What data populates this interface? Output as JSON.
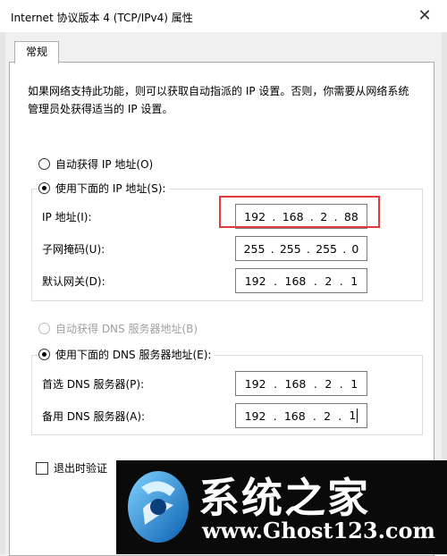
{
  "window": {
    "title": "Internet 协议版本 4 (TCP/IPv4) 属性",
    "close_symbol": "✕"
  },
  "tabs": [
    {
      "label": "常规"
    }
  ],
  "description": "如果网络支持此功能，则可以获取自动指派的 IP 设置。否则，你需要从网络系统管理员处获得适当的 IP 设置。",
  "ip_section": {
    "auto_label": "自动获得 IP 地址(O)",
    "manual_label": "使用下面的 IP 地址(S):",
    "fields": [
      {
        "label": "IP 地址(I):",
        "octets": [
          "192",
          "168",
          "2",
          "88"
        ]
      },
      {
        "label": "子网掩码(U):",
        "octets": [
          "255",
          "255",
          "255",
          "0"
        ]
      },
      {
        "label": "默认网关(D):",
        "octets": [
          "192",
          "168",
          "2",
          "1"
        ]
      }
    ]
  },
  "dns_section": {
    "auto_label": "自动获得 DNS 服务器地址(B)",
    "manual_label": "使用下面的 DNS 服务器地址(E):",
    "fields": [
      {
        "label": "首选 DNS 服务器(P):",
        "octets": [
          "192",
          "168",
          "2",
          "1"
        ]
      },
      {
        "label": "备用 DNS 服务器(A):",
        "octets": [
          "192",
          "168",
          "2",
          "1"
        ]
      }
    ]
  },
  "validate_label": "退出时验证",
  "watermark": {
    "title": "系统之家",
    "url": "www.Ghost123.com"
  },
  "colors": {
    "highlight": "#e33a3a",
    "panel_bg": "#ffffff",
    "window_bg": "#f0f0f0"
  }
}
